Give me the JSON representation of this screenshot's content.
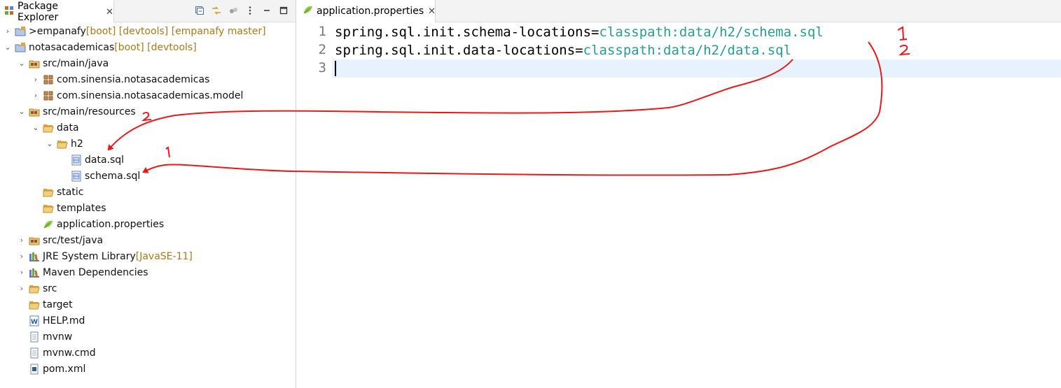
{
  "explorer": {
    "tab_label": "Package Explorer",
    "close_glyph": "✕",
    "tree": [
      {
        "id": "empanafy",
        "depth": 0,
        "chev": "›",
        "icon": "project-icon",
        "prefix": "> ",
        "label": "empanafy",
        "decor": " [boot] [devtools] [empanafy master]"
      },
      {
        "id": "notasacademicas",
        "depth": 0,
        "chev": "⌄",
        "icon": "project-icon",
        "prefix": "",
        "label": "notasacademicas",
        "decor": " [boot] [devtools]"
      },
      {
        "id": "src-main-java",
        "depth": 1,
        "chev": "⌄",
        "icon": "source-folder-icon",
        "prefix": "",
        "label": "src/main/java",
        "decor": ""
      },
      {
        "id": "pkg-root",
        "depth": 2,
        "chev": "›",
        "icon": "package-icon",
        "prefix": "",
        "label": "com.sinensia.notasacademicas",
        "decor": ""
      },
      {
        "id": "pkg-model",
        "depth": 2,
        "chev": "›",
        "icon": "package-icon",
        "prefix": "",
        "label": "com.sinensia.notasacademicas.model",
        "decor": ""
      },
      {
        "id": "src-main-resources",
        "depth": 1,
        "chev": "⌄",
        "icon": "source-folder-icon",
        "prefix": "",
        "label": "src/main/resources",
        "decor": ""
      },
      {
        "id": "data",
        "depth": 2,
        "chev": "⌄",
        "icon": "folder-open-icon",
        "prefix": "",
        "label": "data",
        "decor": ""
      },
      {
        "id": "h2",
        "depth": 3,
        "chev": "⌄",
        "icon": "folder-open-icon",
        "prefix": "",
        "label": "h2",
        "decor": ""
      },
      {
        "id": "data-sql",
        "depth": 4,
        "chev": "",
        "icon": "sql-file-icon",
        "prefix": "",
        "label": "data.sql",
        "decor": ""
      },
      {
        "id": "schema-sql",
        "depth": 4,
        "chev": "",
        "icon": "sql-file-icon",
        "prefix": "",
        "label": "schema.sql",
        "decor": ""
      },
      {
        "id": "static",
        "depth": 2,
        "chev": "",
        "icon": "folder-open-icon",
        "prefix": "",
        "label": "static",
        "decor": ""
      },
      {
        "id": "templates",
        "depth": 2,
        "chev": "",
        "icon": "folder-open-icon",
        "prefix": "",
        "label": "templates",
        "decor": ""
      },
      {
        "id": "application-properties",
        "depth": 2,
        "chev": "",
        "icon": "spring-leaf-icon",
        "prefix": "",
        "label": "application.properties",
        "decor": ""
      },
      {
        "id": "src-test-java",
        "depth": 1,
        "chev": "›",
        "icon": "source-folder-icon",
        "prefix": "",
        "label": "src/test/java",
        "decor": ""
      },
      {
        "id": "jre",
        "depth": 1,
        "chev": "›",
        "icon": "library-icon",
        "prefix": "",
        "label": "JRE System Library",
        "decor": " [JavaSE-11]"
      },
      {
        "id": "maven-deps",
        "depth": 1,
        "chev": "›",
        "icon": "library-icon",
        "prefix": "",
        "label": "Maven Dependencies",
        "decor": ""
      },
      {
        "id": "src",
        "depth": 1,
        "chev": "›",
        "icon": "folder-open-icon",
        "prefix": "",
        "label": "src",
        "decor": ""
      },
      {
        "id": "target",
        "depth": 1,
        "chev": "",
        "icon": "folder-open-icon",
        "prefix": "",
        "label": "target",
        "decor": ""
      },
      {
        "id": "help-md",
        "depth": 1,
        "chev": "",
        "icon": "word-file-icon",
        "prefix": "",
        "label": "HELP.md",
        "decor": ""
      },
      {
        "id": "mvnw",
        "depth": 1,
        "chev": "",
        "icon": "text-file-icon",
        "prefix": "",
        "label": "mvnw",
        "decor": ""
      },
      {
        "id": "mvnw-cmd",
        "depth": 1,
        "chev": "",
        "icon": "text-file-icon",
        "prefix": "",
        "label": "mvnw.cmd",
        "decor": ""
      },
      {
        "id": "pom-xml",
        "depth": 1,
        "chev": "",
        "icon": "xml-file-icon",
        "prefix": "",
        "label": "pom.xml",
        "decor": ""
      }
    ]
  },
  "editor": {
    "tab_label": "application.properties",
    "close_glyph": "✕",
    "lines": [
      {
        "num": "1",
        "key": "spring.sql.init.schema-locations",
        "eq": "=",
        "val": "classpath:data/h2/schema.sql"
      },
      {
        "num": "2",
        "key": "spring.sql.init.data-locations",
        "eq": "=",
        "val": "classpath:data/h2/data.sql"
      },
      {
        "num": "3",
        "key": "",
        "eq": "",
        "val": ""
      }
    ]
  },
  "annotations": {
    "color": "#e8191b",
    "labels": [
      "1",
      "2",
      "2",
      "1"
    ]
  },
  "colors": {
    "value": "#2a9d8f",
    "decor": "#a87a1a",
    "current_line": "#e8f2fe"
  }
}
